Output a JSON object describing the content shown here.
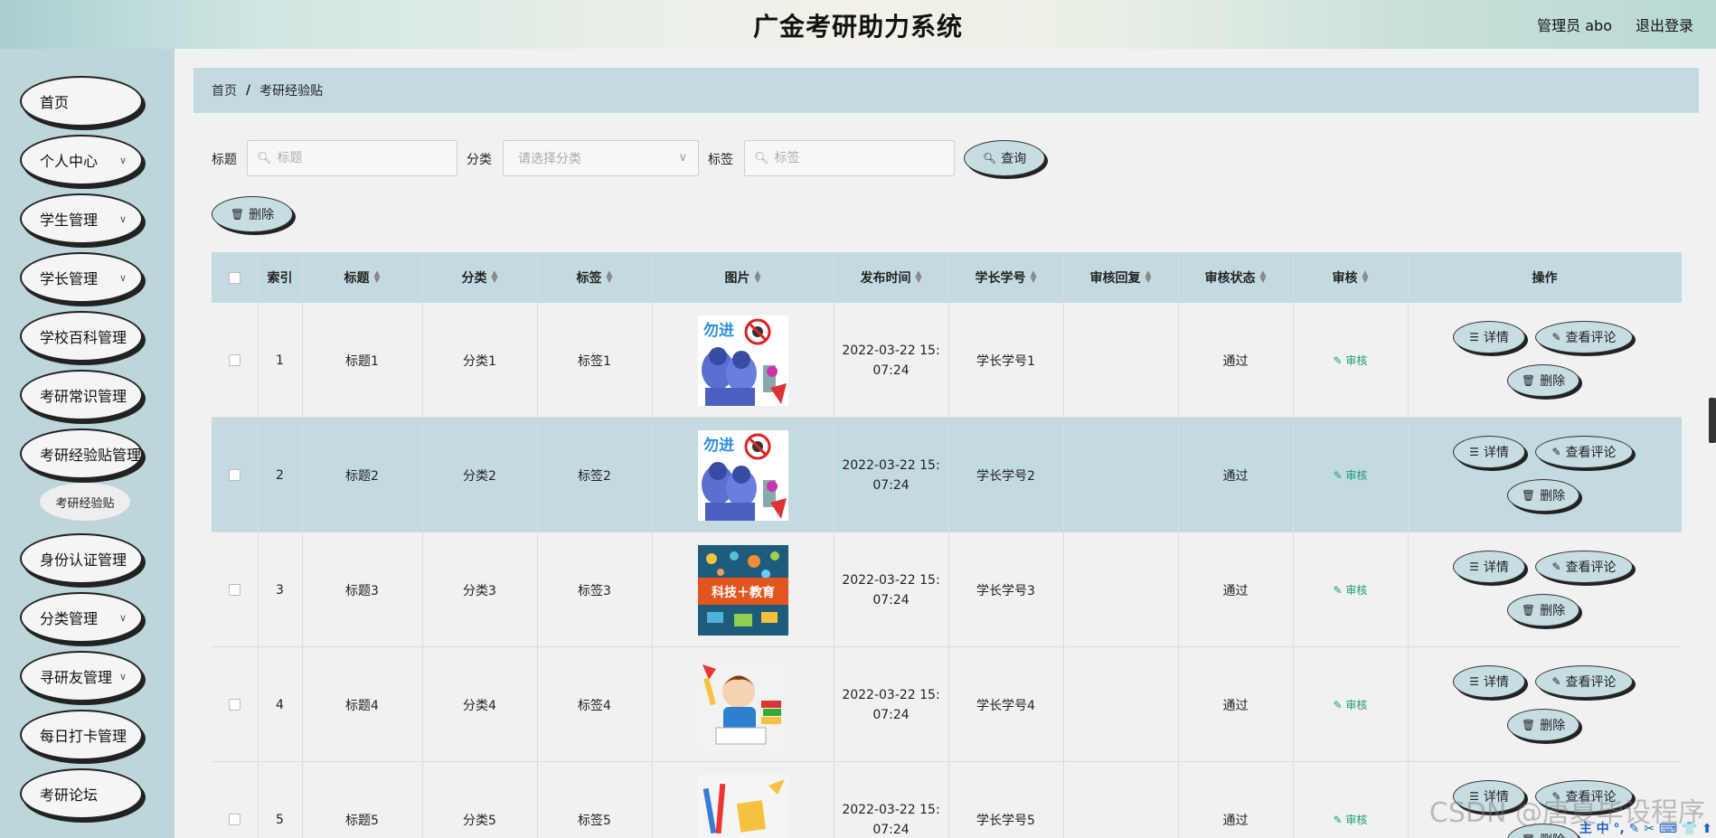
{
  "header": {
    "title": "广金考研助力系统",
    "user": "管理员 abo",
    "logout": "退出登录"
  },
  "sidebar": {
    "items": [
      {
        "label": "首页",
        "has_arrow": false
      },
      {
        "label": "个人中心",
        "has_arrow": true
      },
      {
        "label": "学生管理",
        "has_arrow": true
      },
      {
        "label": "学长管理",
        "has_arrow": true
      },
      {
        "label": "学校百科管理",
        "has_arrow": false
      },
      {
        "label": "考研常识管理",
        "has_arrow": false
      },
      {
        "label": "考研经验贴管理",
        "has_arrow": false
      },
      {
        "label": "身份认证管理",
        "has_arrow": false
      },
      {
        "label": "分类管理",
        "has_arrow": true
      },
      {
        "label": "寻研友管理",
        "has_arrow": true
      },
      {
        "label": "每日打卡管理",
        "has_arrow": false
      },
      {
        "label": "考研论坛",
        "has_arrow": false
      }
    ],
    "submenu": "考研经验贴"
  },
  "breadcrumb": {
    "home": "首页",
    "separator": "/",
    "current": "考研经验贴"
  },
  "search": {
    "title_label": "标题",
    "title_placeholder": "标题",
    "category_label": "分类",
    "category_placeholder": "请选择分类",
    "tag_label": "标签",
    "tag_placeholder": "标签",
    "query_button": "查询",
    "delete_button": "删除"
  },
  "table": {
    "headers": [
      "索引",
      "标题",
      "分类",
      "标签",
      "图片",
      "发布时间",
      "学长学号",
      "审核回复",
      "审核状态",
      "审核",
      "操作"
    ],
    "rows": [
      {
        "index": "1",
        "title": "标题1",
        "category": "分类1",
        "tag": "标签1",
        "image": "virus",
        "time1": "2022-03-22 15:",
        "time2": "07:24",
        "student_no": "学长学号1",
        "reply": "",
        "status": "通过",
        "audit": "审核"
      },
      {
        "index": "2",
        "title": "标题2",
        "category": "分类2",
        "tag": "标签2",
        "image": "virus",
        "time1": "2022-03-22 15:",
        "time2": "07:24",
        "student_no": "学长学号2",
        "reply": "",
        "status": "通过",
        "audit": "审核"
      },
      {
        "index": "3",
        "title": "标题3",
        "category": "分类3",
        "tag": "标签3",
        "image": "tech",
        "time1": "2022-03-22 15:",
        "time2": "07:24",
        "student_no": "学长学号3",
        "reply": "",
        "status": "通过",
        "audit": "审核"
      },
      {
        "index": "4",
        "title": "标题4",
        "category": "分类4",
        "tag": "标签4",
        "image": "child",
        "time1": "2022-03-22 15:",
        "time2": "07:24",
        "student_no": "学长学号4",
        "reply": "",
        "status": "通过",
        "audit": "审核"
      },
      {
        "index": "5",
        "title": "标题5",
        "category": "分类5",
        "tag": "标签5",
        "image": "stationery",
        "time1": "2022-03-22 15:",
        "time2": "07:24",
        "student_no": "学长学号5",
        "reply": "",
        "status": "通过",
        "audit": "审核"
      }
    ],
    "actions": {
      "detail": "详情",
      "comments": "查看评论",
      "delete": "删除"
    },
    "highlighted_row": 2
  },
  "image_text": {
    "virus": "勿进",
    "tech": "科技＋教育"
  },
  "watermark": "CSDN @唐夏毕设程序",
  "taskstrip": "主 中 °, ✎ ✂ ⌨ 👕 ⬆",
  "colors": {
    "header_bg": "#c3dbe0",
    "sidebar_bg": "#bdd6da",
    "audit": "#1a9b7a"
  }
}
